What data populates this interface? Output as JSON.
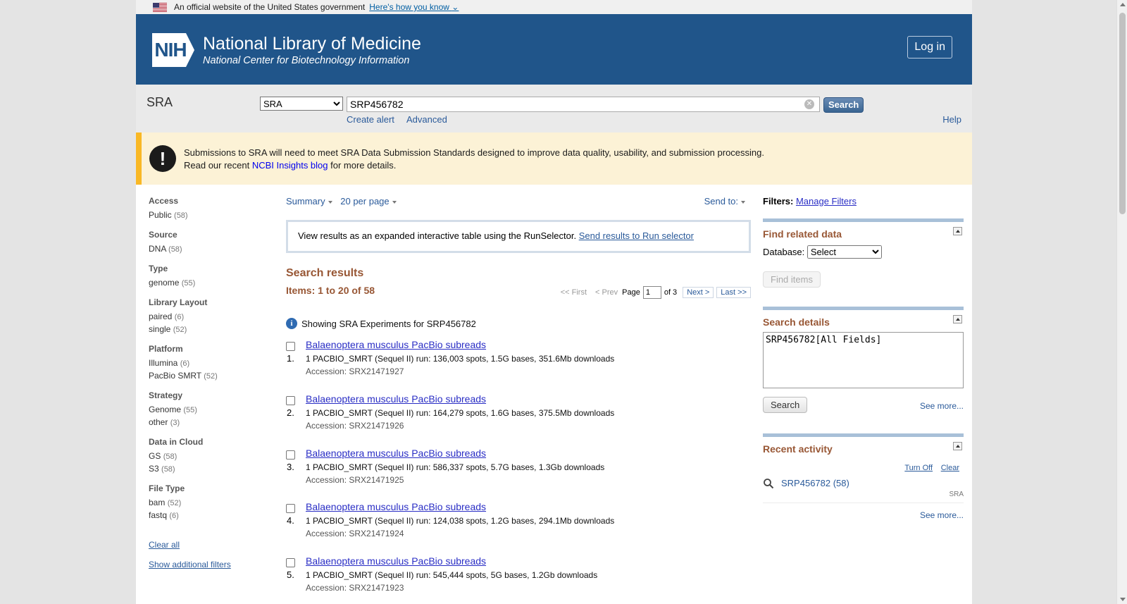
{
  "gov_banner": {
    "text": "An official website of the United States government",
    "link": "Here's how you know"
  },
  "header": {
    "logo_text": "NIH",
    "title": "National Library of Medicine",
    "subtitle": "National Center for Biotechnology Information",
    "login": "Log in"
  },
  "search": {
    "db_label": "SRA",
    "db_selected": "SRA",
    "term": "SRP456782",
    "button": "Search",
    "create_alert": "Create alert",
    "advanced": "Advanced",
    "help": "Help"
  },
  "notice": {
    "line1": "Submissions to SRA will need to meet SRA Data Submission Standards designed to improve data quality, usability, and submission processing.",
    "line2_pre": "Read our recent ",
    "line2_link": "NCBI Insights blog",
    "line2_post": " for more details."
  },
  "facets": [
    {
      "title": "Access",
      "items": [
        {
          "label": "Public",
          "count": "(58)"
        }
      ]
    },
    {
      "title": "Source",
      "items": [
        {
          "label": "DNA",
          "count": "(58)"
        }
      ]
    },
    {
      "title": "Type",
      "items": [
        {
          "label": "genome",
          "count": "(55)"
        }
      ]
    },
    {
      "title": "Library Layout",
      "items": [
        {
          "label": "paired",
          "count": "(6)"
        },
        {
          "label": "single",
          "count": "(52)"
        }
      ]
    },
    {
      "title": "Platform",
      "items": [
        {
          "label": "Illumina",
          "count": "(6)"
        },
        {
          "label": "PacBio SMRT",
          "count": "(52)"
        }
      ]
    },
    {
      "title": "Strategy",
      "items": [
        {
          "label": "Genome",
          "count": "(55)"
        },
        {
          "label": "other",
          "count": "(3)"
        }
      ]
    },
    {
      "title": "Data in Cloud",
      "items": [
        {
          "label": "GS",
          "count": "(58)"
        },
        {
          "label": "S3",
          "count": "(58)"
        }
      ]
    },
    {
      "title": "File Type",
      "items": [
        {
          "label": "bam",
          "count": "(52)"
        },
        {
          "label": "fastq",
          "count": "(6)"
        }
      ]
    }
  ],
  "facet_links": {
    "clear_all": "Clear all",
    "show_additional": "Show additional filters"
  },
  "display": {
    "format": "Summary",
    "per_page": "20 per page",
    "send_to": "Send to:"
  },
  "runselector": {
    "text": "View results as an expanded interactive table using the RunSelector.",
    "link": "Send results to Run selector"
  },
  "results": {
    "title": "Search results",
    "items_count": "Items: 1 to 20 of 58",
    "showing": "Showing SRA Experiments for SRP456782",
    "pager": {
      "first": "<< First",
      "prev": "< Prev",
      "page_label": "Page",
      "page_value": "1",
      "of": "of 3",
      "next": "Next >",
      "last": "Last >>"
    },
    "list": [
      {
        "num": "1.",
        "title": "Balaenoptera musculus PacBio subreads",
        "desc": "1 PACBIO_SMRT (Sequel II) run: 136,003 spots, 1.5G bases, 351.6Mb downloads",
        "acc": "Accession: SRX21471927"
      },
      {
        "num": "2.",
        "title": "Balaenoptera musculus PacBio subreads",
        "desc": "1 PACBIO_SMRT (Sequel II) run: 164,279 spots, 1.6G bases, 375.5Mb downloads",
        "acc": "Accession: SRX21471926"
      },
      {
        "num": "3.",
        "title": "Balaenoptera musculus PacBio subreads",
        "desc": "1 PACBIO_SMRT (Sequel II) run: 586,337 spots, 5.7G bases, 1.3Gb downloads",
        "acc": "Accession: SRX21471925"
      },
      {
        "num": "4.",
        "title": "Balaenoptera musculus PacBio subreads",
        "desc": "1 PACBIO_SMRT (Sequel II) run: 124,038 spots, 1.2G bases, 294.1Mb downloads",
        "acc": "Accession: SRX21471924"
      },
      {
        "num": "5.",
        "title": "Balaenoptera musculus PacBio subreads",
        "desc": "1 PACBIO_SMRT (Sequel II) run: 545,444 spots, 5G bases, 1.2Gb downloads",
        "acc": "Accession: SRX21471923"
      }
    ]
  },
  "right": {
    "filters_label": "Filters:",
    "manage_filters": "Manage Filters",
    "related_title": "Find related data",
    "database_label": "Database:",
    "database_selected": "Select",
    "find_items": "Find items",
    "details_title": "Search details",
    "details_query": "SRP456782[All Fields]",
    "details_search": "Search",
    "see_more": "See more...",
    "recent_title": "Recent activity",
    "turn_off": "Turn Off",
    "clear": "Clear",
    "recent_item": "SRP456782 (58)",
    "recent_db": "SRA"
  }
}
